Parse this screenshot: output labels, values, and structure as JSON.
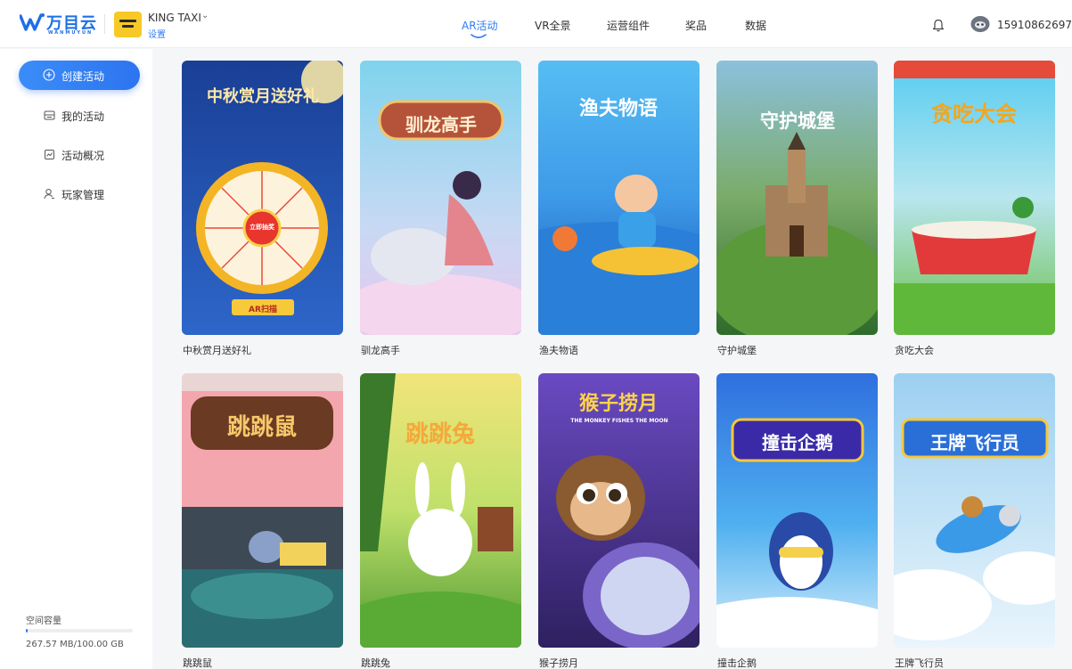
{
  "header": {
    "logo_text": "万目云",
    "logo_sub": "WANMUYUN",
    "brand_name": "KING TAXI",
    "brand_settings": "设置",
    "nav": [
      {
        "label": "AR活动",
        "active": true
      },
      {
        "label": "VR全景",
        "active": false
      },
      {
        "label": "运营组件",
        "active": false
      },
      {
        "label": "奖品",
        "active": false
      },
      {
        "label": "数据",
        "active": false
      }
    ],
    "phone": "15910862697",
    "icons": [
      "bell-icon",
      "avatar-icon",
      "chevron-down-icon"
    ]
  },
  "sidebar": {
    "create_label": "创建活动",
    "items": [
      {
        "label": "我的活动",
        "icon": "folder-icon"
      },
      {
        "label": "活动概况",
        "icon": "chart-icon"
      },
      {
        "label": "玩家管理",
        "icon": "user-icon"
      }
    ],
    "storage_title": "空间容量",
    "storage_text": "267.57 MB/100.00 GB",
    "storage_used_fraction": 0.0026
  },
  "cards": [
    {
      "title": "中秋赏月送好礼",
      "poster_text": "中秋赏月送好礼",
      "button_text": "AR扫描",
      "wheel_center": "立即抽奖",
      "colors": [
        "#1c3f8f",
        "#2a5fbf"
      ],
      "icon": "prize-wheel-illustration"
    },
    {
      "title": "驯龙高手",
      "poster_text": "驯龙高手",
      "colors": [
        "#8fd6f0",
        "#d9c6ef"
      ],
      "icon": "dragon-rider-illustration"
    },
    {
      "title": "渔夫物语",
      "poster_text": "渔夫物语",
      "colors": [
        "#4fb0f0",
        "#1d63c6"
      ],
      "icon": "fisherman-illustration"
    },
    {
      "title": "守护城堡",
      "poster_text": "守护城堡",
      "colors": [
        "#6fa6c9",
        "#3f7f3a"
      ],
      "icon": "castle-illustration"
    },
    {
      "title": "贪吃大会",
      "poster_text": "贪吃大会",
      "colors": [
        "#5ed0f0",
        "#6cc04a"
      ],
      "icon": "feast-table-illustration"
    },
    {
      "title": "跳跳鼠",
      "poster_text": "跳跳鼠",
      "colors": [
        "#f4a0a8",
        "#2a6d73"
      ],
      "icon": "mouse-kitchen-illustration"
    },
    {
      "title": "跳跳兔",
      "poster_text": "跳跳兔",
      "colors": [
        "#e8d86a",
        "#5aa03a"
      ],
      "icon": "rabbit-illustration"
    },
    {
      "title": "猴子捞月",
      "poster_text": "猴子捞月",
      "poster_subtext": "THE MONKEY FISHES THE MOON",
      "colors": [
        "#5d3fb0",
        "#2e2060"
      ],
      "icon": "monkey-illustration"
    },
    {
      "title": "撞击企鹅",
      "poster_text": "撞击企鹅",
      "colors": [
        "#2f6fdf",
        "#bfe3f8"
      ],
      "icon": "penguin-illustration"
    },
    {
      "title": "王牌飞行员",
      "poster_text": "王牌飞行员",
      "colors": [
        "#a8d6f2",
        "#e8f4fb"
      ],
      "icon": "plane-illustration"
    }
  ]
}
